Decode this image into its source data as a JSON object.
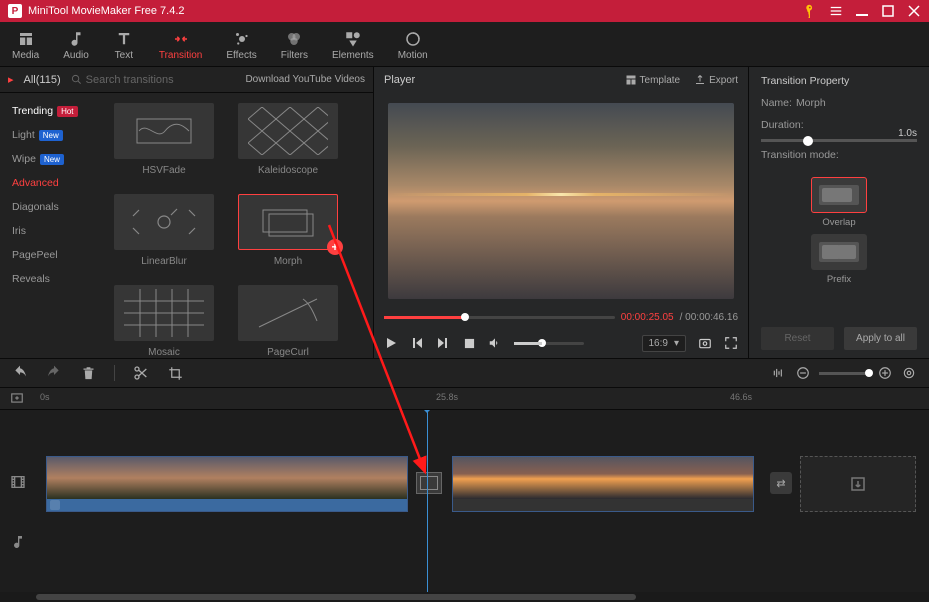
{
  "app": {
    "title": "MiniTool MovieMaker Free 7.4.2"
  },
  "toolbar": {
    "media": "Media",
    "audio": "Audio",
    "text": "Text",
    "transition": "Transition",
    "effects": "Effects",
    "filters": "Filters",
    "elements": "Elements",
    "motion": "Motion"
  },
  "browse": {
    "all_count": "All(115)",
    "search_placeholder": "Search transitions",
    "download_link": "Download YouTube Videos",
    "categories": [
      {
        "label": "Trending",
        "badge": "Hot",
        "badgeClass": "badge-hot"
      },
      {
        "label": "Light",
        "badge": "New",
        "badgeClass": "badge-new"
      },
      {
        "label": "Wipe",
        "badge": "New",
        "badgeClass": "badge-new"
      },
      {
        "label": "Advanced",
        "active": true
      },
      {
        "label": "Diagonals"
      },
      {
        "label": "Iris"
      },
      {
        "label": "PagePeel"
      },
      {
        "label": "Reveals"
      }
    ],
    "thumbs": {
      "hsvfade": "HSVFade",
      "kaleidoscope": "Kaleidoscope",
      "linearblur": "LinearBlur",
      "morph": "Morph",
      "mosaic": "Mosaic",
      "pagecurl": "PageCurl"
    }
  },
  "player": {
    "title": "Player",
    "template_btn": "Template",
    "export_btn": "Export",
    "current_time": "00:00:25.05",
    "total_time": "00:00:46.16",
    "ratio": "16:9"
  },
  "props": {
    "panel_title": "Transition Property",
    "name_label": "Name:",
    "name_value": "Morph",
    "duration_label": "Duration:",
    "duration_value": "1.0s",
    "mode_label": "Transition mode:",
    "overlap": "Overlap",
    "prefix": "Prefix",
    "reset": "Reset",
    "apply_all": "Apply to all"
  },
  "timeline": {
    "t0": "0s",
    "t1": "25.8s",
    "t2": "46.6s"
  }
}
